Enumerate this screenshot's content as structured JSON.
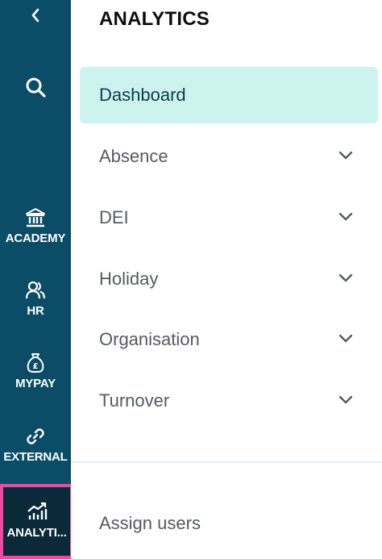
{
  "rail": {
    "collapse_icon": "chevron-left-icon",
    "search_icon": "search-icon",
    "items": [
      {
        "label": "ACADEMY",
        "icon": "bank-icon"
      },
      {
        "label": "HR",
        "icon": "users-icon"
      },
      {
        "label": "MYPAY",
        "icon": "money-bag-icon"
      },
      {
        "label": "EXTERNAL",
        "icon": "link-icon"
      },
      {
        "label": "ANALYTI...",
        "icon": "chart-up-icon",
        "active": true
      }
    ]
  },
  "panel": {
    "title": "ANALYTICS",
    "active_item": "Dashboard",
    "items": [
      {
        "label": "Absence"
      },
      {
        "label": "DEI"
      },
      {
        "label": "Holiday"
      },
      {
        "label": "Organisation"
      },
      {
        "label": "Turnover"
      }
    ],
    "footer_item": "Assign users"
  },
  "colors": {
    "rail_bg": "#0b4c66",
    "rail_active_bg": "#0a2a3a",
    "highlight_border": "#ec4ba0",
    "active_item_bg": "#cdf3ee"
  }
}
